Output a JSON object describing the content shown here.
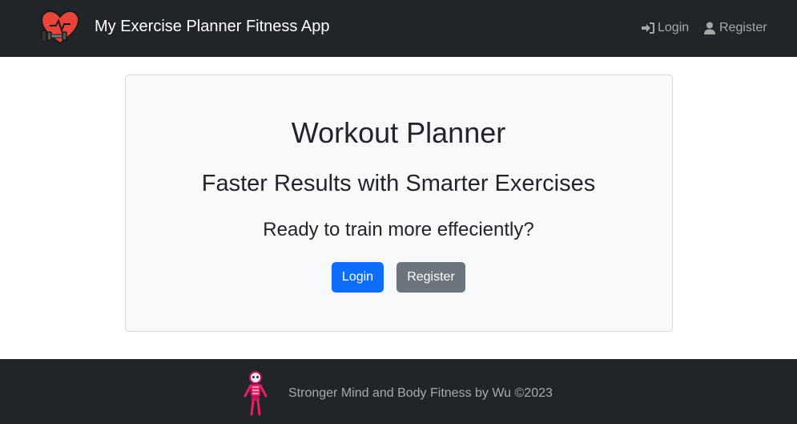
{
  "navbar": {
    "brand_title": "My Exercise Planner Fitness App",
    "logo_icon": "heart-dumbbell-icon",
    "links": {
      "login_label": "Login",
      "register_label": "Register"
    }
  },
  "hero": {
    "title": "Workout Planner",
    "subtitle": "Faster Results with Smarter Exercises",
    "question": "Ready to train more effeciently?",
    "login_button": "Login",
    "register_button": "Register"
  },
  "footer": {
    "text": "Stronger Mind and Body Fitness by Wu ©2023",
    "logo_icon": "skeleton-icon"
  },
  "colors": {
    "navbar_bg": "#212529",
    "primary": "#0d6efd",
    "secondary": "#6c757d",
    "card_bg": "#f8f9fa"
  }
}
